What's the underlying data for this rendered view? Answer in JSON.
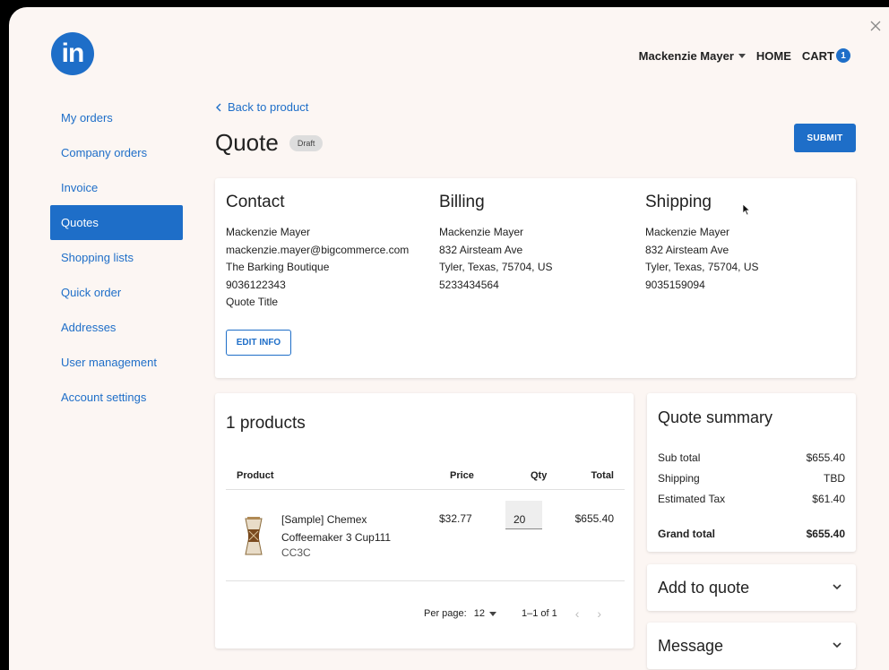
{
  "header": {
    "logo_text": "in",
    "user_name": "Mackenzie Mayer",
    "home_label": "HOME",
    "cart_label": "CART",
    "cart_count": "1"
  },
  "sidebar": {
    "items": [
      {
        "label": "My orders"
      },
      {
        "label": "Company orders"
      },
      {
        "label": "Invoice"
      },
      {
        "label": "Quotes",
        "active": true
      },
      {
        "label": "Shopping lists"
      },
      {
        "label": "Quick order"
      },
      {
        "label": "Addresses"
      },
      {
        "label": "User management"
      },
      {
        "label": "Account settings"
      }
    ]
  },
  "page": {
    "back_label": "Back to product",
    "title": "Quote",
    "status": "Draft",
    "submit_label": "SUBMIT"
  },
  "contact": {
    "heading": "Contact",
    "lines": [
      "Mackenzie Mayer",
      "mackenzie.mayer@bigcommerce.com",
      "The Barking Boutique",
      "9036122343",
      "Quote Title"
    ],
    "edit_label": "EDIT INFO"
  },
  "billing": {
    "heading": "Billing",
    "lines": [
      "Mackenzie Mayer",
      "832 Airsteam Ave",
      "Tyler, Texas, 75704, US",
      "5233434564"
    ]
  },
  "shipping": {
    "heading": "Shipping",
    "lines": [
      "Mackenzie Mayer",
      "832 Airsteam Ave",
      "Tyler, Texas, 75704, US",
      "9035159094"
    ]
  },
  "products": {
    "heading": "1 products",
    "columns": {
      "product": "Product",
      "price": "Price",
      "qty": "Qty",
      "total": "Total"
    },
    "rows": [
      {
        "name": "[Sample] Chemex Coffeemaker 3 Cup111",
        "sku": "CC3C",
        "price": "$32.77",
        "qty": "20",
        "total": "$655.40"
      }
    ],
    "per_page_label": "Per page:",
    "per_page_value": "12",
    "range": "1–1 of 1"
  },
  "summary": {
    "heading": "Quote summary",
    "sub_total_label": "Sub total",
    "sub_total": "$655.40",
    "shipping_label": "Shipping",
    "shipping": "TBD",
    "tax_label": "Estimated Tax",
    "tax": "$61.40",
    "grand_total_label": "Grand total",
    "grand_total": "$655.40"
  },
  "add_to_quote": {
    "label": "Add to quote"
  },
  "message": {
    "label": "Message"
  },
  "colors": {
    "accent": "#1e6ec8",
    "background": "#fcf6f3"
  }
}
